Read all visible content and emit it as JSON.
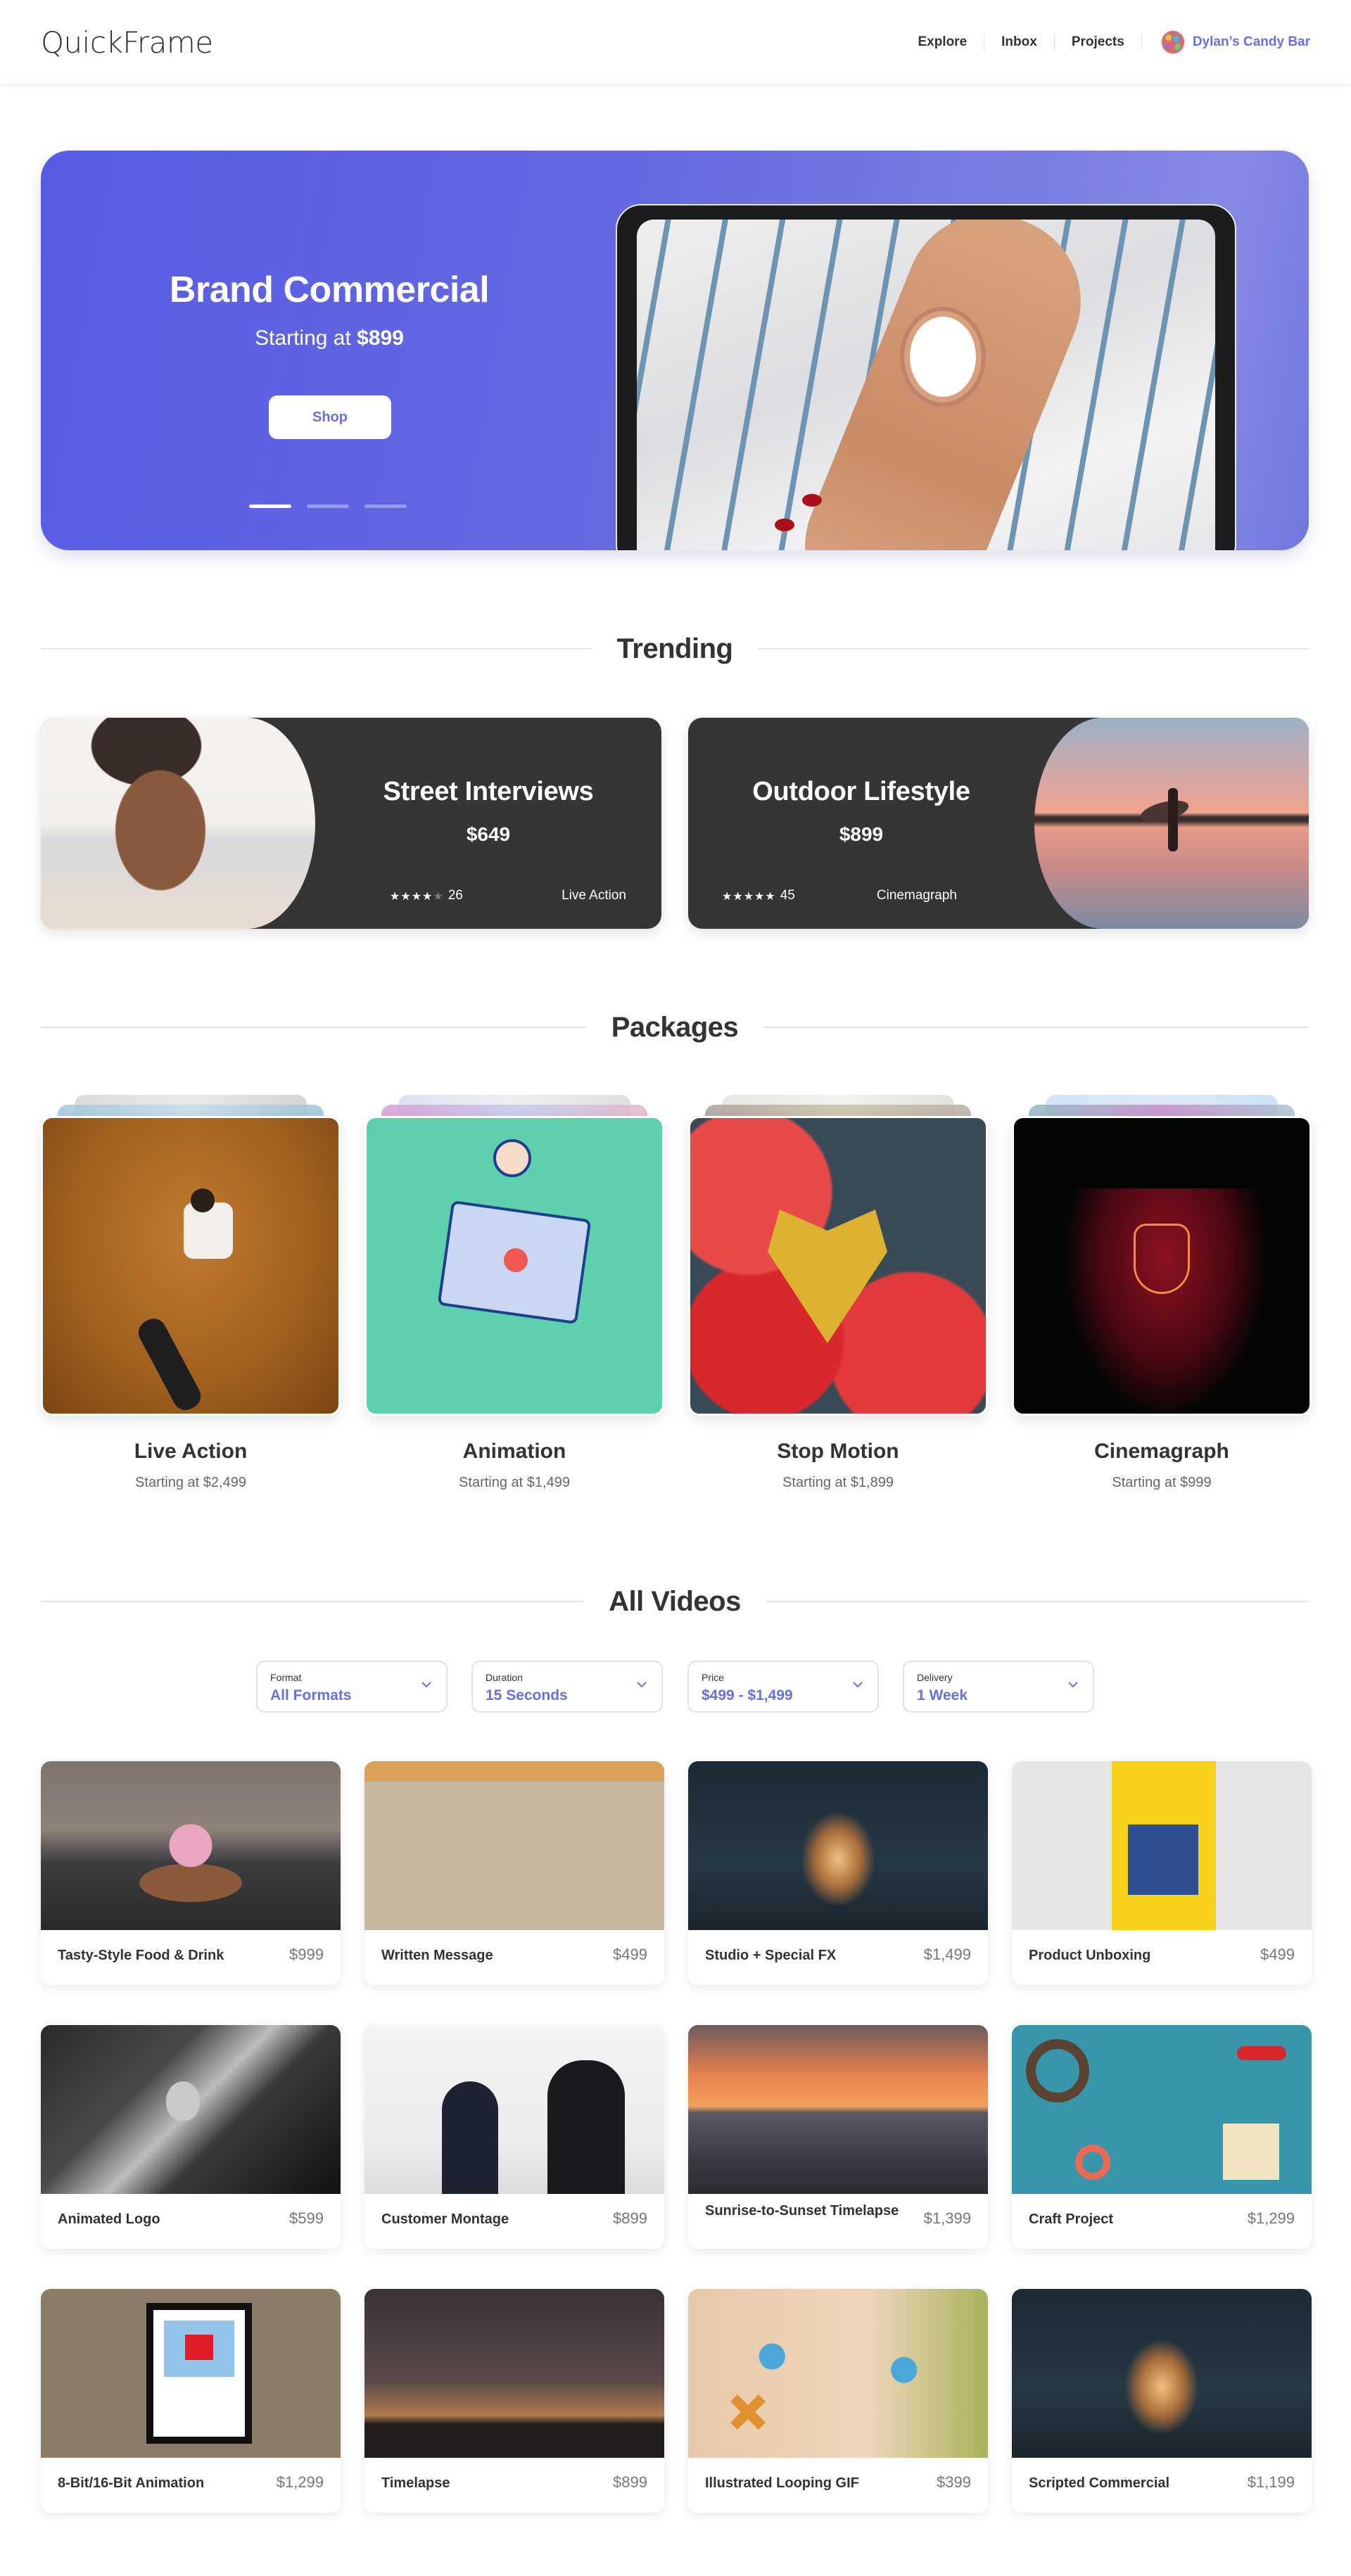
{
  "header": {
    "logo": "QuickFrame",
    "nav": [
      "Explore",
      "Inbox",
      "Projects"
    ],
    "account_name": "Dylan’s Candy Bar",
    "accent_color": "#6a6fe0"
  },
  "hero": {
    "title": "Brand Commercial",
    "subtitle_prefix": "Starting at",
    "subtitle_price": "$899",
    "button": "Shop",
    "slides": 3,
    "active_slide": 1
  },
  "trending": {
    "title": "Trending",
    "items": [
      {
        "title": "Street Interviews",
        "price": "$649",
        "rating": 4,
        "rating_max": 5,
        "reviews": "26",
        "category": "Live Action"
      },
      {
        "title": "Outdoor Lifestyle",
        "price": "$899",
        "rating": 5,
        "rating_max": 5,
        "reviews": "45",
        "category": "Cinemagraph"
      }
    ]
  },
  "packages": {
    "title": "Packages",
    "items": [
      {
        "name": "Live Action",
        "price": "Starting at $2,499"
      },
      {
        "name": "Animation",
        "price": "Starting at $1,499"
      },
      {
        "name": "Stop Motion",
        "price": "Starting at $1,899"
      },
      {
        "name": "Cinemagraph",
        "price": "Starting at $999"
      }
    ]
  },
  "all_videos": {
    "title": "All Videos",
    "filters": [
      {
        "label": "Format",
        "value": "All Formats"
      },
      {
        "label": "Duration",
        "value": "15 Seconds"
      },
      {
        "label": "Price",
        "value": "$499 - $1,499"
      },
      {
        "label": "Delivery",
        "value": "1 Week"
      }
    ],
    "videos": [
      {
        "title": "Tasty-Style Food & Drink",
        "price": "$999"
      },
      {
        "title": "Written Message",
        "price": "$499"
      },
      {
        "title": "Studio + Special FX",
        "price": "$1,499"
      },
      {
        "title": "Product Unboxing",
        "price": "$499"
      },
      {
        "title": "Animated Logo",
        "price": "$599"
      },
      {
        "title": "Customer Montage",
        "price": "$899"
      },
      {
        "title": "Sunrise-to-Sunset Timelapse",
        "price": "$1,399"
      },
      {
        "title": "Craft Project",
        "price": "$1,299"
      },
      {
        "title": "8-Bit/16-Bit Animation",
        "price": "$1,299"
      },
      {
        "title": "Timelapse",
        "price": "$899"
      },
      {
        "title": "Illustrated Looping GIF",
        "price": "$399"
      },
      {
        "title": "Scripted Commercial",
        "price": "$1,199"
      }
    ]
  }
}
